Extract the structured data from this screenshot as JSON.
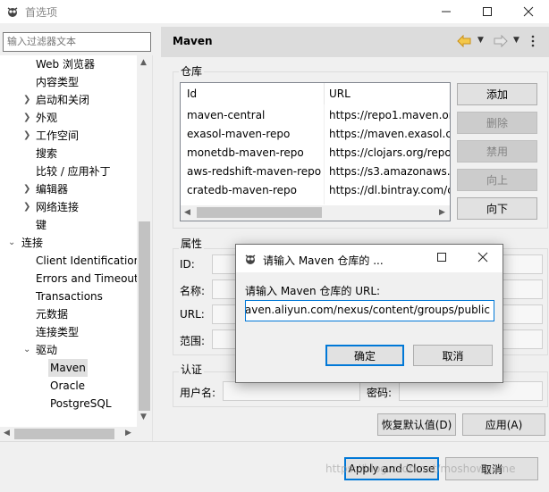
{
  "window": {
    "title": "首选项",
    "icons": {
      "app": "eclipse-icon",
      "minimize": "minimize-icon",
      "maximize": "maximize-icon",
      "close": "close-icon"
    }
  },
  "filter": {
    "placeholder": "输入过滤器文本"
  },
  "tree": {
    "items": [
      {
        "label": "Web 浏览器",
        "expander": false
      },
      {
        "label": "内容类型",
        "expander": false
      },
      {
        "label": "启动和关闭",
        "expander": true,
        "state": "collapsed"
      },
      {
        "label": "外观",
        "expander": true,
        "state": "collapsed"
      },
      {
        "label": "工作空间",
        "expander": true,
        "state": "collapsed"
      },
      {
        "label": "搜索",
        "expander": false
      },
      {
        "label": "比较 / 应用补丁",
        "expander": false
      },
      {
        "label": "编辑器",
        "expander": true,
        "state": "collapsed"
      },
      {
        "label": "网络连接",
        "expander": true,
        "state": "collapsed"
      },
      {
        "label": "键",
        "expander": false
      },
      {
        "label": "连接",
        "expander": true,
        "state": "expanded"
      },
      {
        "label": "Client Identification",
        "expander": false
      },
      {
        "label": "Errors and Timeout",
        "expander": false
      },
      {
        "label": "Transactions",
        "expander": false
      },
      {
        "label": "元数据",
        "expander": false
      },
      {
        "label": "连接类型",
        "expander": false
      },
      {
        "label": "驱动",
        "expander": true,
        "state": "expanded"
      },
      {
        "label": "Maven",
        "expander": false,
        "selected": true
      },
      {
        "label": "Oracle",
        "expander": false
      },
      {
        "label": "PostgreSQL",
        "expander": false
      }
    ]
  },
  "page": {
    "title": "Maven",
    "nav_icons": [
      "back-arrow-icon",
      "dropdown-icon",
      "forward-arrow-icon",
      "dropdown-icon",
      "menu-icon"
    ]
  },
  "repositories": {
    "group_label": "仓库",
    "columns": [
      "Id",
      "URL"
    ],
    "rows": [
      {
        "id": "maven-central",
        "url": "https://repo1.maven.or"
      },
      {
        "id": "exasol-maven-repo",
        "url": "https://maven.exasol.co"
      },
      {
        "id": "monetdb-maven-repo",
        "url": "https://clojars.org/repo"
      },
      {
        "id": "aws-redshift-maven-repo",
        "url": "https://s3.amazonaws.c"
      },
      {
        "id": "cratedb-maven-repo",
        "url": "https://dl.bintray.com/c"
      }
    ],
    "buttons": {
      "add": "添加",
      "delete": "删除",
      "disable": "禁用",
      "up": "向上",
      "down": "向下"
    }
  },
  "properties": {
    "group_label": "属性",
    "labels": {
      "id": "ID:",
      "name": "名称:",
      "url": "URL:",
      "scope": "范围:"
    }
  },
  "auth": {
    "group_label": "认证",
    "username_label": "用户名:",
    "password_label": "密码:"
  },
  "page_buttons": {
    "restore": "恢复默认值(D)",
    "apply": "应用(A)"
  },
  "footer": {
    "apply_close": "Apply and Close",
    "cancel": "取消"
  },
  "dialog": {
    "title": "请输入 Maven 仓库的 ...",
    "prompt": "请输入 Maven 仓库的 URL:",
    "value": "aven.aliyun.com/nexus/content/groups/public/",
    "ok": "确定",
    "cancel": "取消"
  },
  "watermark": "https://blog.csdn.net/moshowgame",
  "colors": {
    "focus": "#0078d7",
    "selection": "#e0e0e0",
    "header": "#dcdcdc",
    "back_arrow": "#e8a317"
  }
}
